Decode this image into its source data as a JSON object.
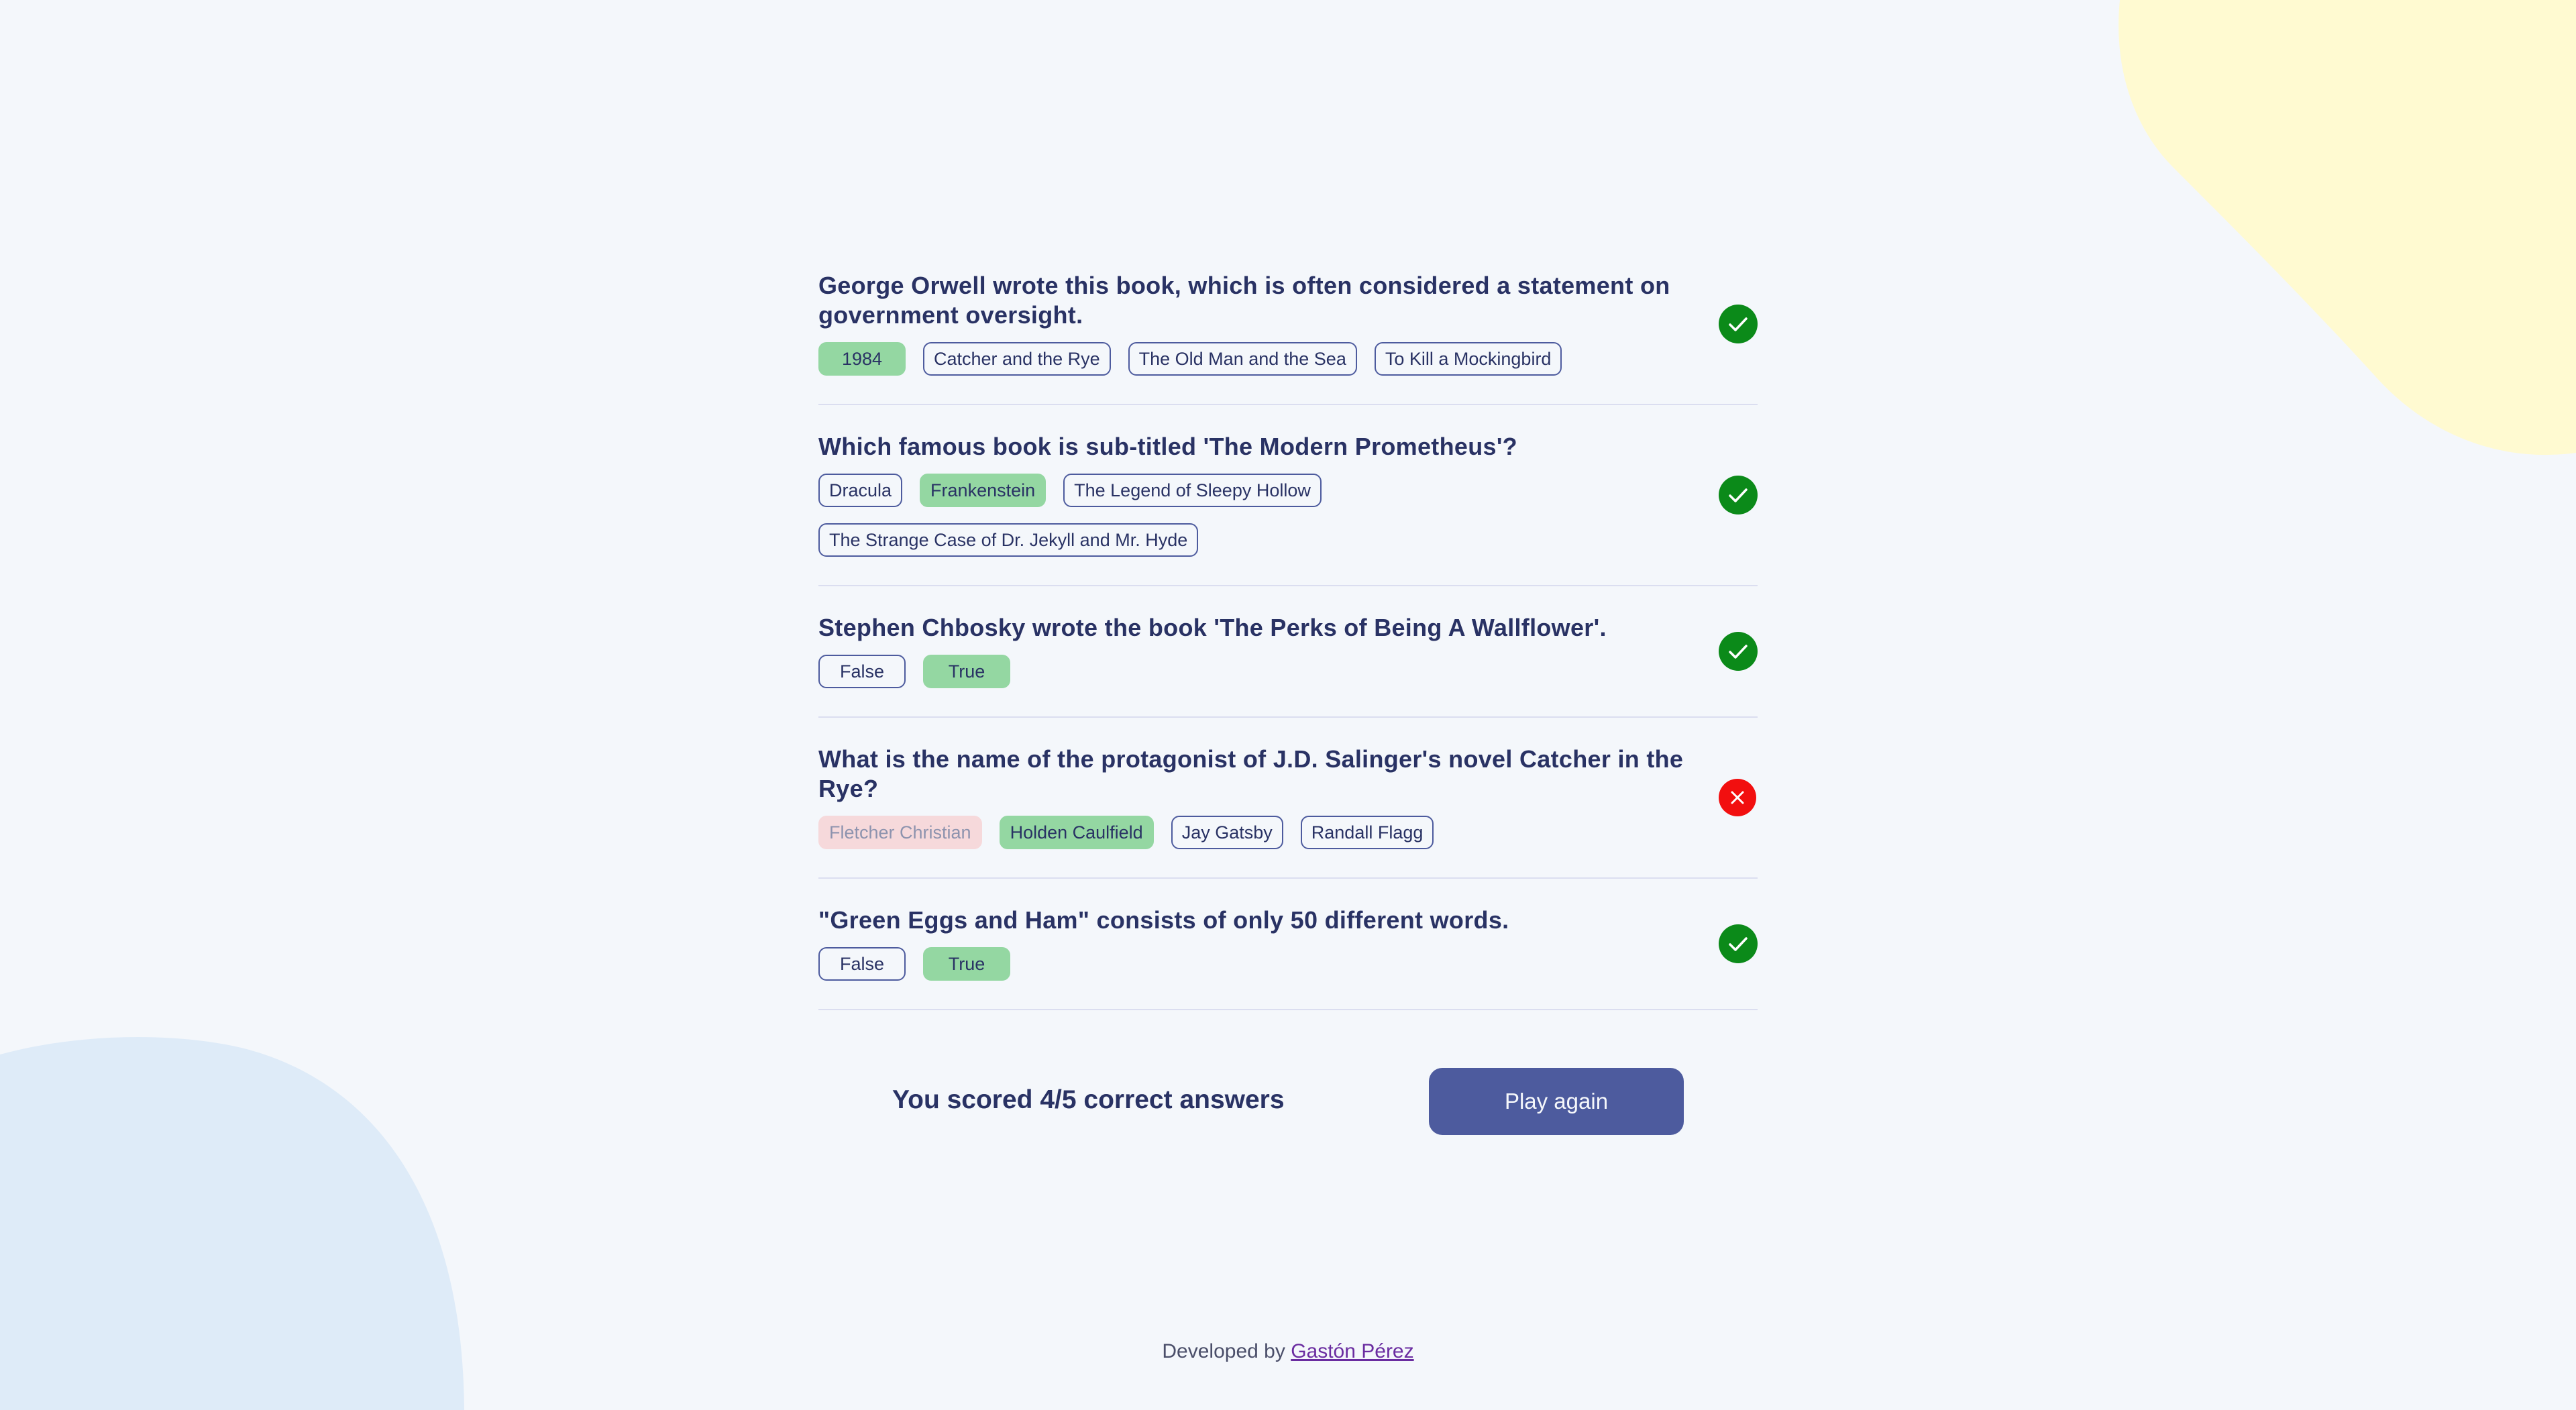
{
  "colors": {
    "background": "#f4f7fb",
    "text": "#293264",
    "correct_answer": "#94d7a2",
    "wrong_answer": "#f8bcbc",
    "correct_icon": "#0b8a19",
    "wrong_icon": "#f20f0f",
    "button": "#4d5b9e",
    "blob_yellow": "#fffad1",
    "blob_blue": "#deebf8"
  },
  "questions": [
    {
      "text": "George Orwell wrote this book, which is often considered a statement on government oversight.",
      "answers": [
        {
          "label": "1984",
          "state": "correct"
        },
        {
          "label": "Catcher and the Rye",
          "state": "plain"
        },
        {
          "label": "The Old Man and the Sea",
          "state": "plain"
        },
        {
          "label": "To Kill a Mockingbird",
          "state": "plain"
        }
      ],
      "result": "check-icon"
    },
    {
      "text": "Which famous book is sub-titled 'The Modern Prometheus'?",
      "answers": [
        {
          "label": "Dracula",
          "state": "plain"
        },
        {
          "label": "Frankenstein",
          "state": "correct"
        },
        {
          "label": "The Legend of Sleepy Hollow",
          "state": "plain"
        },
        {
          "label": "The Strange Case of Dr. Jekyll and Mr. Hyde",
          "state": "plain"
        }
      ],
      "result": "check-icon"
    },
    {
      "text": "Stephen Chbosky wrote the book 'The Perks of Being A Wallflower'.",
      "answers": [
        {
          "label": "False",
          "state": "plain"
        },
        {
          "label": "True",
          "state": "correct"
        }
      ],
      "result": "check-icon"
    },
    {
      "text": "What is the name of the protagonist of J.D. Salinger's novel Catcher in the Rye?",
      "answers": [
        {
          "label": "Fletcher Christian",
          "state": "wrong"
        },
        {
          "label": "Holden Caulfield",
          "state": "correct"
        },
        {
          "label": "Jay Gatsby",
          "state": "plain"
        },
        {
          "label": "Randall Flagg",
          "state": "plain"
        }
      ],
      "result": "cross-icon"
    },
    {
      "text": "\"Green Eggs and Ham\" consists of only 50 different words.",
      "answers": [
        {
          "label": "False",
          "state": "plain"
        },
        {
          "label": "True",
          "state": "correct"
        }
      ],
      "result": "check-icon"
    }
  ],
  "score": {
    "text": "You scored 4/5 correct answers",
    "button_label": "Play again"
  },
  "footer": {
    "prefix": "Developed by",
    "author": "Gastón Pérez"
  }
}
